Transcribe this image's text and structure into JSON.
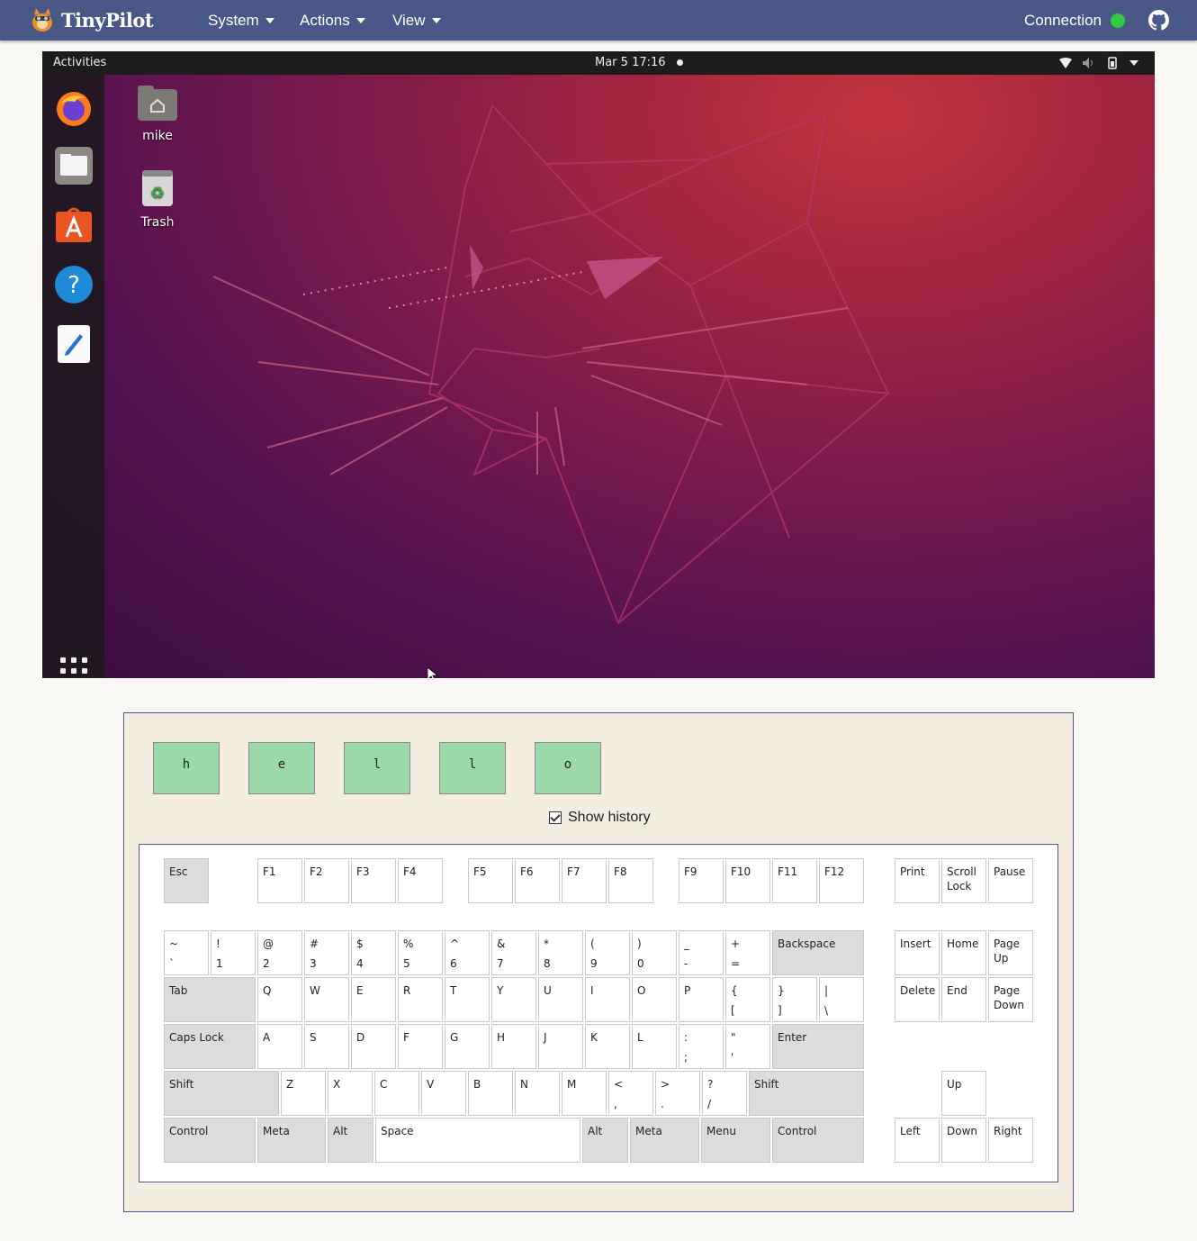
{
  "app": {
    "name": "TinyPilot"
  },
  "nav": {
    "menus": [
      {
        "label": "System",
        "name": "menu-system"
      },
      {
        "label": "Actions",
        "name": "menu-actions"
      },
      {
        "label": "View",
        "name": "menu-view"
      }
    ],
    "connection_label": "Connection",
    "connection_status_color": "#2ecc40"
  },
  "remote": {
    "activities": "Activities",
    "clock": "Mar 5  17:16",
    "desktop_icons": [
      {
        "label": "mike",
        "icon": "home-folder-icon"
      },
      {
        "label": "Trash",
        "icon": "trash-icon"
      }
    ],
    "dock": [
      "firefox-icon",
      "files-icon",
      "software-store-icon",
      "help-icon",
      "text-editor-icon"
    ]
  },
  "history": {
    "keys": [
      "h",
      "e",
      "l",
      "l",
      "o"
    ],
    "show_history_label": "Show history",
    "show_history_checked": true
  },
  "keyboard": {
    "fn_row": [
      "Esc",
      "F1",
      "F2",
      "F3",
      "F4",
      "F5",
      "F6",
      "F7",
      "F8",
      "F9",
      "F10",
      "F11",
      "F12"
    ],
    "sys_row": [
      "Print",
      "Scroll Lock",
      "Pause"
    ],
    "number_row": [
      {
        "hi": "~",
        "lo": "`"
      },
      {
        "hi": "!",
        "lo": "1"
      },
      {
        "hi": "@",
        "lo": "2"
      },
      {
        "hi": "#",
        "lo": "3"
      },
      {
        "hi": "$",
        "lo": "4"
      },
      {
        "hi": "%",
        "lo": "5"
      },
      {
        "hi": "^",
        "lo": "6"
      },
      {
        "hi": "&",
        "lo": "7"
      },
      {
        "hi": "*",
        "lo": "8"
      },
      {
        "hi": "(",
        "lo": "9"
      },
      {
        "hi": ")",
        "lo": "0"
      },
      {
        "hi": "_",
        "lo": "-"
      },
      {
        "hi": "+",
        "lo": "="
      }
    ],
    "backspace": "Backspace",
    "tab": "Tab",
    "q_row": [
      "Q",
      "W",
      "E",
      "R",
      "T",
      "Y",
      "U",
      "I",
      "O",
      "P"
    ],
    "q_row_sym": [
      {
        "hi": "{",
        "lo": "["
      },
      {
        "hi": "}",
        "lo": "]"
      },
      {
        "hi": "|",
        "lo": "\\"
      }
    ],
    "caps": "Caps Lock",
    "a_row": [
      "A",
      "S",
      "D",
      "F",
      "G",
      "H",
      "J",
      "K",
      "L"
    ],
    "a_row_sym": [
      {
        "hi": ":",
        "lo": ";"
      },
      {
        "hi": "\"",
        "lo": "'"
      }
    ],
    "enter": "Enter",
    "shift": "Shift",
    "z_row": [
      "Z",
      "X",
      "C",
      "V",
      "B",
      "N",
      "M"
    ],
    "z_row_sym": [
      {
        "hi": "<",
        "lo": ","
      },
      {
        "hi": ">",
        "lo": "."
      },
      {
        "hi": "?",
        "lo": "/"
      }
    ],
    "bottom": [
      "Control",
      "Meta",
      "Alt",
      "Space",
      "Alt",
      "Meta",
      "Menu",
      "Control"
    ],
    "nav_cluster": [
      "Insert",
      "Home",
      "Page Up",
      "Delete",
      "End",
      "Page Down"
    ],
    "arrows": [
      "Up",
      "Left",
      "Down",
      "Right"
    ]
  }
}
